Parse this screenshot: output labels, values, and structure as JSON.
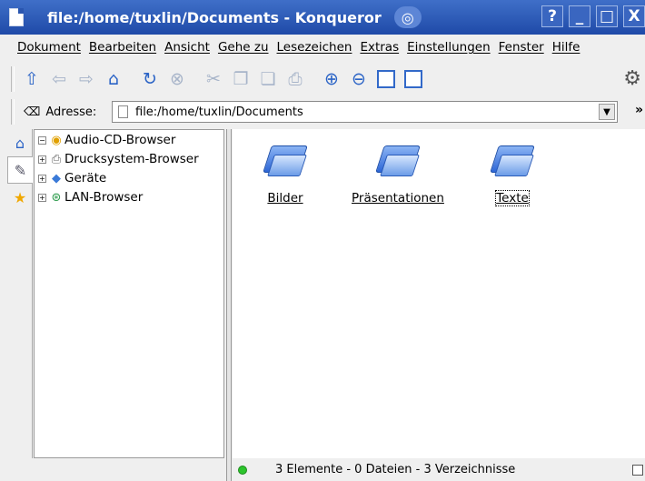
{
  "window": {
    "title": "file:/home/tuxlin/Documents - Konqueror",
    "buttons": [
      "?",
      "_",
      "□",
      "X"
    ]
  },
  "menu": [
    "Dokument",
    "Bearbeiten",
    "Ansicht",
    "Gehe zu",
    "Lesezeichen",
    "Extras",
    "Einstellungen",
    "Fenster",
    "Hilfe"
  ],
  "toolbar": {
    "icons": [
      "up-arrow-icon",
      "back-arrow-icon",
      "forward-arrow-icon",
      "home-icon",
      "reload-icon",
      "stop-icon",
      "cut-icon",
      "copy-icon",
      "paste-icon",
      "print-icon",
      "zoom-in-icon",
      "zoom-out-icon",
      "icon-view-icon",
      "tree-view-icon",
      "gear-icon"
    ]
  },
  "location": {
    "label": "Adresse:",
    "value": "file:/home/tuxlin/Documents",
    "more": "»"
  },
  "sidebar": {
    "tabs": [
      "home-icon",
      "history-icon",
      "bookmarks-star-icon"
    ],
    "items": [
      {
        "label": "Audio-CD-Browser",
        "icon": "audio-cd-icon"
      },
      {
        "label": "Drucksystem-Browser",
        "icon": "printer-system-icon"
      },
      {
        "label": "Geräte",
        "icon": "devices-icon"
      },
      {
        "label": "LAN-Browser",
        "icon": "lan-network-icon"
      }
    ]
  },
  "files": [
    {
      "label": "Bilder"
    },
    {
      "label": "Präsentationen"
    },
    {
      "label": "Texte",
      "focused": true
    }
  ],
  "status": {
    "text": "3 Elemente - 0 Dateien - 3 Verzeichnisse",
    "led_color": "#2cc42c"
  },
  "colors": {
    "titlebar": "#2a56b0",
    "accent": "#2a63c6"
  }
}
